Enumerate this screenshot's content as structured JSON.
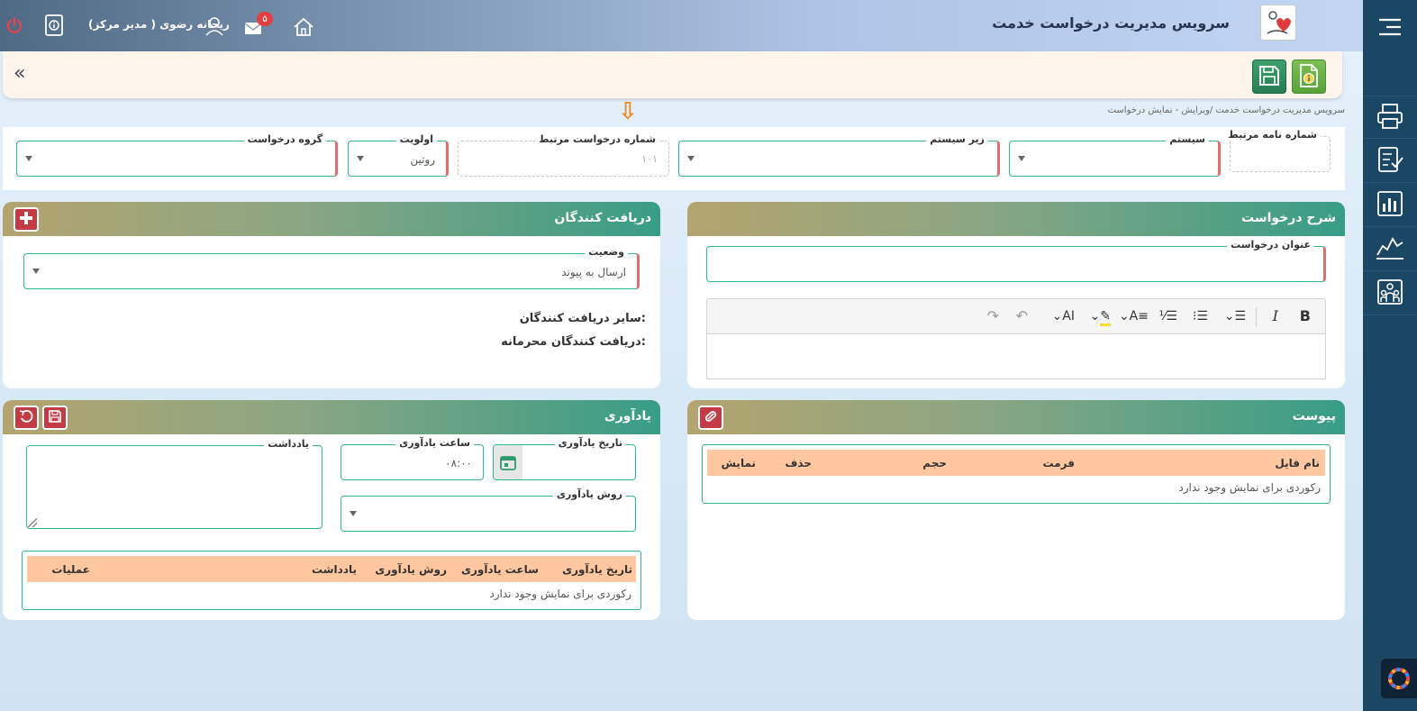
{
  "header": {
    "app_title": "سرویس مدیریت درخواست خدمت",
    "user_name": "ریحانه رضوی ( مدیر مرکز)",
    "unread_messages": "۵"
  },
  "breadcrumb": "سرویس مدیریت درخواست خدمت /ویرایش - نمایش درخواست",
  "filters": {
    "related_letter_no": {
      "label": "شماره نامه مرتبط",
      "value": ""
    },
    "system": {
      "label": "سیستم",
      "value": ""
    },
    "subsystem": {
      "label": "زیر سیستم",
      "value": ""
    },
    "related_request_no": {
      "label": "شماره درخواست مرتبط",
      "value": "۱۰۱"
    },
    "priority": {
      "label": "اولویت",
      "value": "روتین"
    },
    "request_group": {
      "label": "گروه درخواست",
      "value": ""
    }
  },
  "description_card": {
    "title": "شرح درخواست",
    "request_title_label": "عنوان درخواست",
    "request_title_value": ""
  },
  "recipients_card": {
    "title": "دریافت کنندگان",
    "status_label": "وضعیت",
    "status_value": "ارسال به پیوند",
    "other_recipients": "سایر دریافت کنندگان:",
    "confidential_recipients": "دریافت کنندگان محرمانه:"
  },
  "attachments_card": {
    "title": "پیوست",
    "columns": [
      "نام فایل",
      "فرمت",
      "حجم",
      "حذف",
      "نمایش"
    ],
    "empty_text": "رکوردی برای نمایش وجود ندارد"
  },
  "reminder_card": {
    "title": "یادآوری",
    "date_label": "تاریخ یادآوری",
    "date_value": "",
    "time_label": "ساعت یادآوری",
    "time_value": "۰۸:۰۰",
    "note_label": "یادداشت",
    "method_label": "روش یادآوری",
    "method_value": "",
    "columns": [
      "تاریخ یادآوری",
      "ساعت یادآوری",
      "روش یادآوری",
      "یادداشت",
      "عملیات"
    ],
    "empty_text": "رکوردی برای نمایش وجود ندارد"
  },
  "editor_toolbar_icons": [
    "bold-icon",
    "italic-icon",
    "align-icon",
    "bullet-list-icon",
    "numbered-list-icon",
    "font-size-icon",
    "highlight-icon",
    "text-case-icon",
    "undo-icon",
    "redo-icon"
  ],
  "colors": {
    "accent_green": "#2fba86",
    "required_red": "#e26d6d",
    "grid_header": "#ffc79f",
    "sidebar": "#1b4664",
    "button_red": "#c23b45",
    "button_green": "#2e8b5a"
  }
}
